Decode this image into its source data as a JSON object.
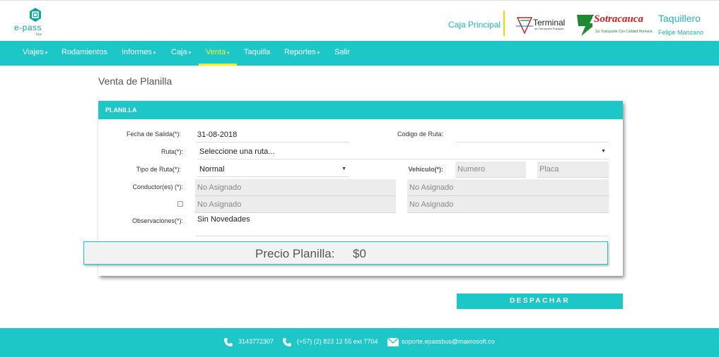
{
  "brand": {
    "logo_text": "e-pass",
    "logo_sub": "bus"
  },
  "header": {
    "caja": "Caja Principal",
    "terminal_name": "Terminal",
    "terminal_small": "de Transporte Popayán",
    "company_name": "Sotracauca",
    "company_tagline": "Su Transporte Con Calidad Humana",
    "user_role": "Taquillero",
    "user_name": "Felipe Manzano"
  },
  "nav": {
    "items": [
      {
        "label": "Viajes",
        "dropdown": true
      },
      {
        "label": "Rodamientos",
        "dropdown": false
      },
      {
        "label": "Informes",
        "dropdown": true
      },
      {
        "label": "Caja",
        "dropdown": true
      },
      {
        "label": "Venta",
        "dropdown": true,
        "active": true
      },
      {
        "label": "Taquilla",
        "dropdown": false
      },
      {
        "label": "Reportes",
        "dropdown": true
      },
      {
        "label": "Salir",
        "dropdown": false
      }
    ],
    "caret": "▾"
  },
  "page": {
    "title": "Venta de Planilla"
  },
  "panel": {
    "heading": "PLANILLA",
    "fecha_label": "Fecha de Salida(*):",
    "fecha_value": "31-08-2018",
    "codigo_label": "Codigo de Ruta:",
    "codigo_value": "",
    "ruta_label": "Ruta(*):",
    "ruta_value": "Seleccione una ruta...",
    "tipo_label": "Tipo de Ruta(*):",
    "tipo_value": "Normal",
    "vehiculo_label": "Vehículo(*):",
    "vehiculo_numero_placeholder": "Numero",
    "vehiculo_placa_placeholder": "Placa",
    "conductor_label": "Conductor(es) (*):",
    "conductor_1": "No Asignado",
    "conductor_2": "No Asignado",
    "conductor_3": "No Asignado",
    "conductor_4": "No Asignado",
    "observaciones_label": "Observaciones(*):",
    "observaciones_value": "Sin Novedades"
  },
  "precio": {
    "label": "Precio Planilla:",
    "value": "$0"
  },
  "actions": {
    "despachar": "DESPACHAR"
  },
  "footer": {
    "phone": "3143772307",
    "phone2": "(+57) (2) 823 12 55 ext 7704",
    "email": "soporte.epassbus@makrosoft.co"
  },
  "colors": {
    "accent": "#1ec7c7",
    "active_nav": "#f4ee28",
    "logo": "#14a39a"
  }
}
